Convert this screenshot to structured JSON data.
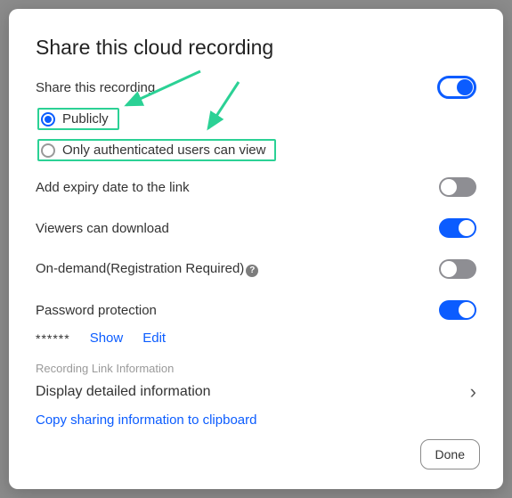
{
  "title": "Share this cloud recording",
  "share_row_label": "Share this recording",
  "share_row_on": true,
  "radio": {
    "publicly": "Publicly",
    "auth_only": "Only authenticated users can view",
    "selected": "publicly"
  },
  "rows": {
    "expiry": {
      "label": "Add expiry date to the link",
      "on": false
    },
    "download": {
      "label": "Viewers can download",
      "on": true
    },
    "ondemand": {
      "label": "On-demand(Registration Required)",
      "on": false
    },
    "password": {
      "label": "Password protection",
      "on": true
    }
  },
  "password": {
    "masked": "******",
    "show_label": "Show",
    "edit_label": "Edit"
  },
  "section_label": "Recording Link Information",
  "detail_label": "Display detailed information",
  "copy_label": "Copy sharing information to clipboard",
  "done_label": "Done",
  "annotation_color": "#2bd195"
}
